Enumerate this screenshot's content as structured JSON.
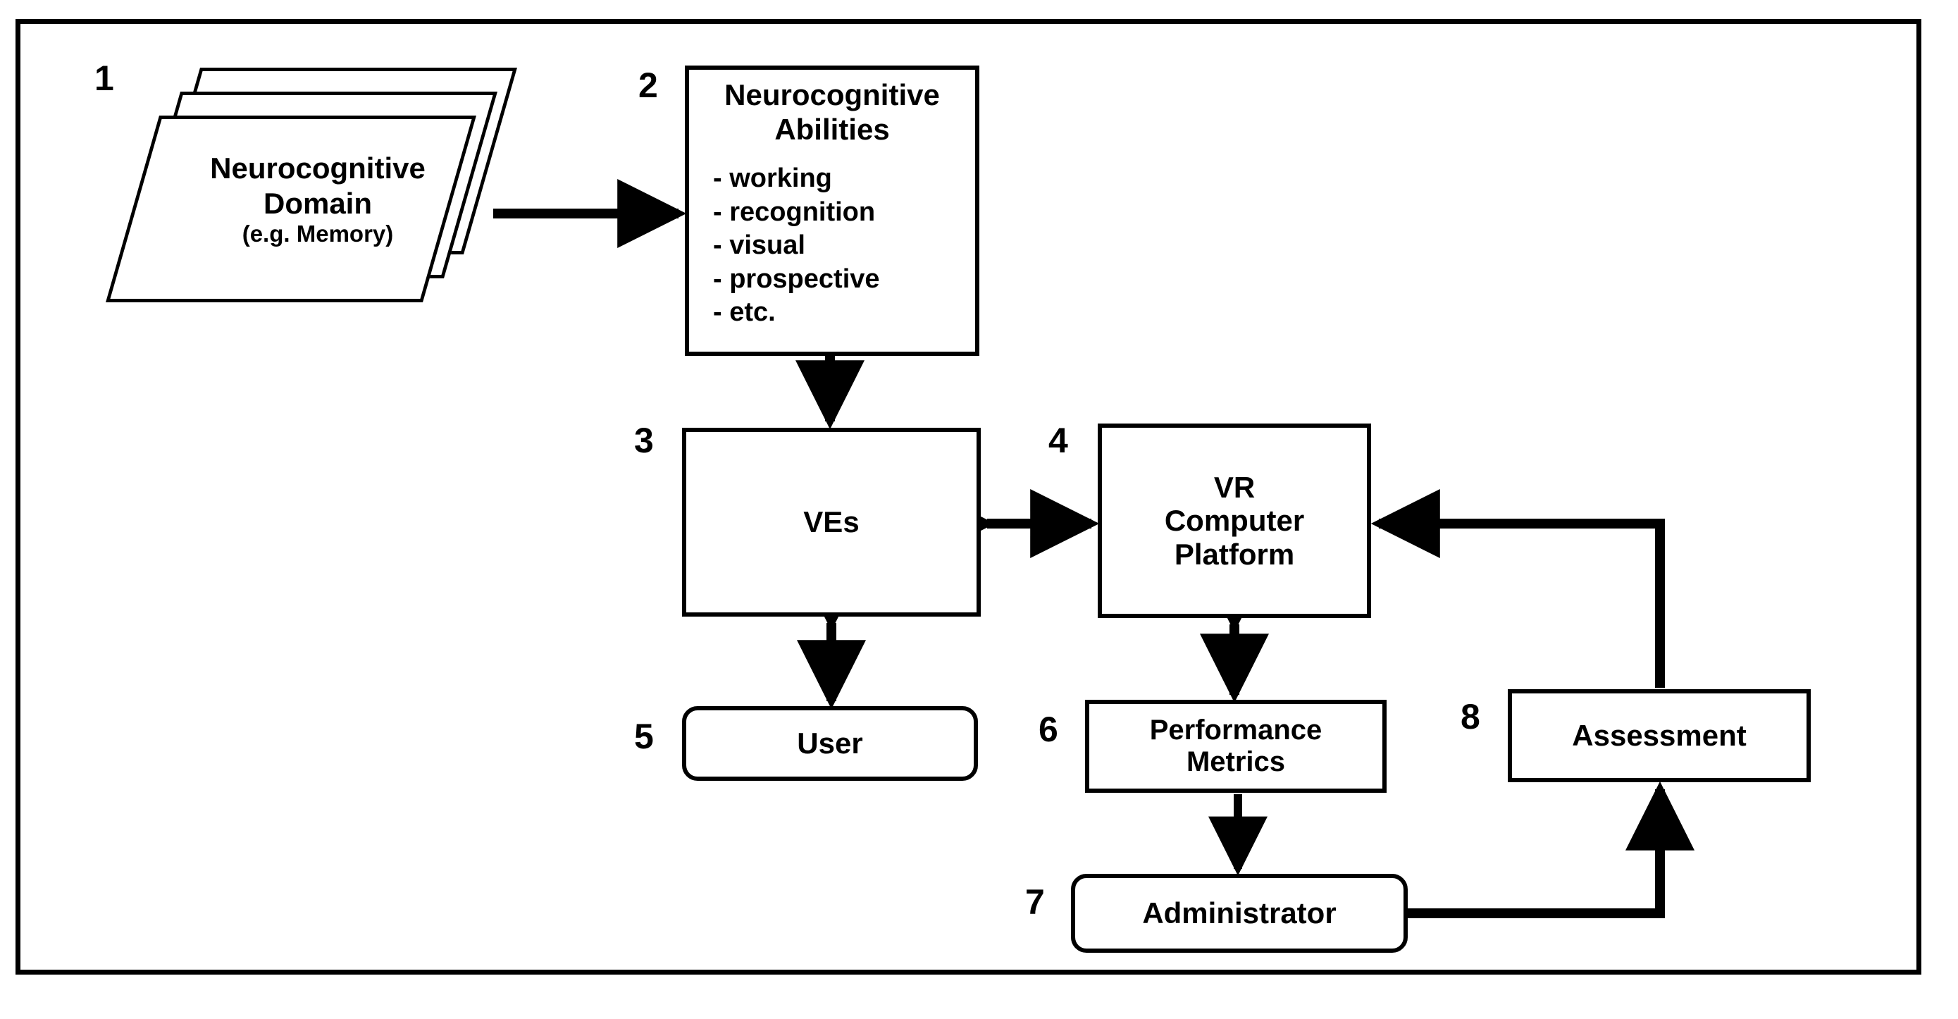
{
  "diagram": {
    "title": "VR neurocognitive assessment system flow diagram",
    "frame_color": "#000000",
    "background_color": "#ffffff",
    "nodes": [
      {
        "number": "1",
        "shape": "stacked-parallelograms",
        "line1": "Neurocognitive",
        "line2": "Domain",
        "line3": "(e.g. Memory)"
      },
      {
        "number": "2",
        "shape": "rectangle",
        "heading_line1": "Neurocognitive",
        "heading_line2": "Abilities",
        "bullets": [
          "- working",
          "- recognition",
          "- visual",
          "- prospective",
          "- etc."
        ]
      },
      {
        "number": "3",
        "shape": "rectangle",
        "label": "VEs"
      },
      {
        "number": "4",
        "shape": "rectangle",
        "line1": "VR",
        "line2": "Computer",
        "line3": "Platform"
      },
      {
        "number": "5",
        "shape": "rounded-rectangle",
        "label": "User"
      },
      {
        "number": "6",
        "shape": "rectangle",
        "line1": "Performance",
        "line2": "Metrics"
      },
      {
        "number": "7",
        "shape": "rounded-rectangle",
        "label": "Administrator"
      },
      {
        "number": "8",
        "shape": "rectangle",
        "label": "Assessment"
      }
    ],
    "connectors": [
      {
        "name": "domain-to-abilities",
        "from": "1",
        "to": "2",
        "arrow": "single",
        "direction": "right"
      },
      {
        "name": "abilities-to-ves",
        "from": "2",
        "to": "3",
        "arrow": "single",
        "direction": "down"
      },
      {
        "name": "ves-to-platform",
        "from": "3",
        "to": "4",
        "arrow": "double",
        "direction": "horizontal"
      },
      {
        "name": "ves-to-user",
        "from": "3",
        "to": "5",
        "arrow": "double",
        "direction": "vertical"
      },
      {
        "name": "platform-to-metrics",
        "from": "4",
        "to": "6",
        "arrow": "double",
        "direction": "vertical"
      },
      {
        "name": "metrics-to-administrator",
        "from": "6",
        "to": "7",
        "arrow": "single",
        "direction": "down"
      },
      {
        "name": "administrator-to-assessment",
        "from": "7",
        "to": "8",
        "arrow": "single",
        "direction": "right-then-up"
      },
      {
        "name": "assessment-to-platform",
        "from": "8",
        "to": "4",
        "arrow": "single",
        "direction": "up-then-left"
      }
    ]
  }
}
